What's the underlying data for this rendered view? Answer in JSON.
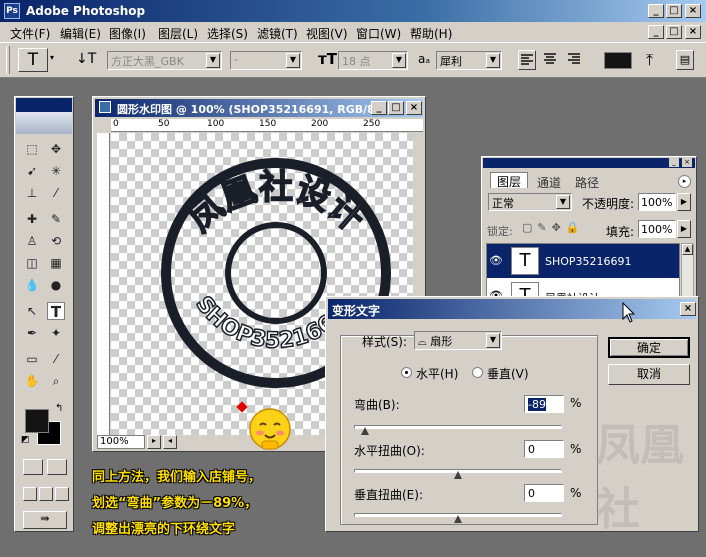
{
  "app": {
    "title": "Adobe Photoshop",
    "icon": "ps-app-icon"
  },
  "menu": [
    "文件(F)",
    "编辑(E)",
    "图像(I)",
    "图层(L)",
    "选择(S)",
    "滤镜(T)",
    "视图(V)",
    "窗口(W)",
    "帮助(H)"
  ],
  "options": {
    "tool_glyph": "T",
    "font_family": "方正大黑_GBK",
    "font_style": "-",
    "font_size": "18 点",
    "aa_label": "aₐ",
    "antialias": "犀利"
  },
  "document": {
    "title": "圆形水印图 @ 100% (SHOP35216691, RGB/8)",
    "zoom": "100%",
    "ruler_marks": [
      "0",
      "50",
      "100",
      "150",
      "200",
      "250"
    ],
    "stamp_top_text": "凤凰社设计",
    "stamp_bottom_text": "SHOP35216691"
  },
  "layers": {
    "tabs": [
      "图层",
      "通道",
      "路径"
    ],
    "blend_mode": "正常",
    "opacity_label": "不透明度:",
    "opacity": "100%",
    "lock_label": "锁定:",
    "fill_label": "填充:",
    "fill": "100%",
    "rows": [
      {
        "name": "SHOP35216691",
        "thumb": "T"
      },
      {
        "name": "凤凰社设计",
        "thumb": "T"
      }
    ]
  },
  "dialog": {
    "title": "变形文字",
    "style_label": "样式(S):",
    "style_value": "扇形",
    "horizontal": "水平(H)",
    "vertical": "垂直(V)",
    "bend_label": "弯曲(B):",
    "bend_value": "-89",
    "hdist_label": "水平扭曲(O):",
    "hdist_value": "0",
    "vdist_label": "垂直扭曲(E):",
    "vdist_value": "0",
    "percent": "%",
    "ok": "确定",
    "cancel": "取消",
    "bend_fraction": 0.055,
    "hdist_fraction": 0.5,
    "vdist_fraction": 0.5
  },
  "caption": [
    "同上方法，我们输入店铺号，",
    "划选“弯曲”参数为－89%，",
    "调整出漂亮的下环绕文字"
  ],
  "watermark": "凤凰社"
}
